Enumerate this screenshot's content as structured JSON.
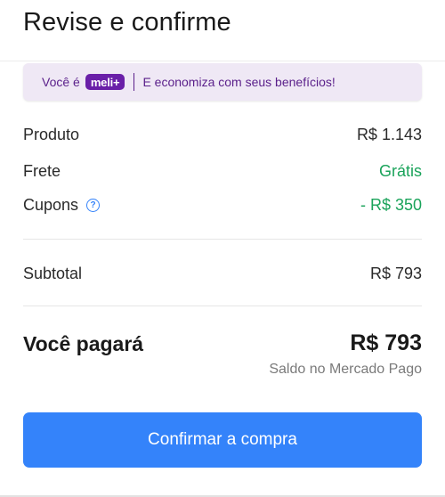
{
  "page": {
    "title": "Revise e confirme"
  },
  "banner": {
    "lead": "Você é",
    "badge": "meli+",
    "text": "E economiza com seus benefícios!"
  },
  "summary": {
    "rows": [
      {
        "label": "Produto",
        "value": "R$ 1.143"
      },
      {
        "label": "Frete",
        "value": "Grátis"
      },
      {
        "label": "Cupons",
        "value": "- R$ 350"
      }
    ],
    "subtotal": {
      "label": "Subtotal",
      "value": "R$ 793"
    },
    "total": {
      "label": "Você pagará",
      "value": "R$ 793",
      "note": "Saldo no Mercado Pago"
    }
  },
  "cta": {
    "label": "Confirmar a compra"
  },
  "icons": {
    "info": "info-circle-icon"
  },
  "colors": {
    "accent": "#3483fa",
    "green": "#1aa35a",
    "meli_purple": "#6a1fa8",
    "banner_bg": "#efe8f5"
  }
}
